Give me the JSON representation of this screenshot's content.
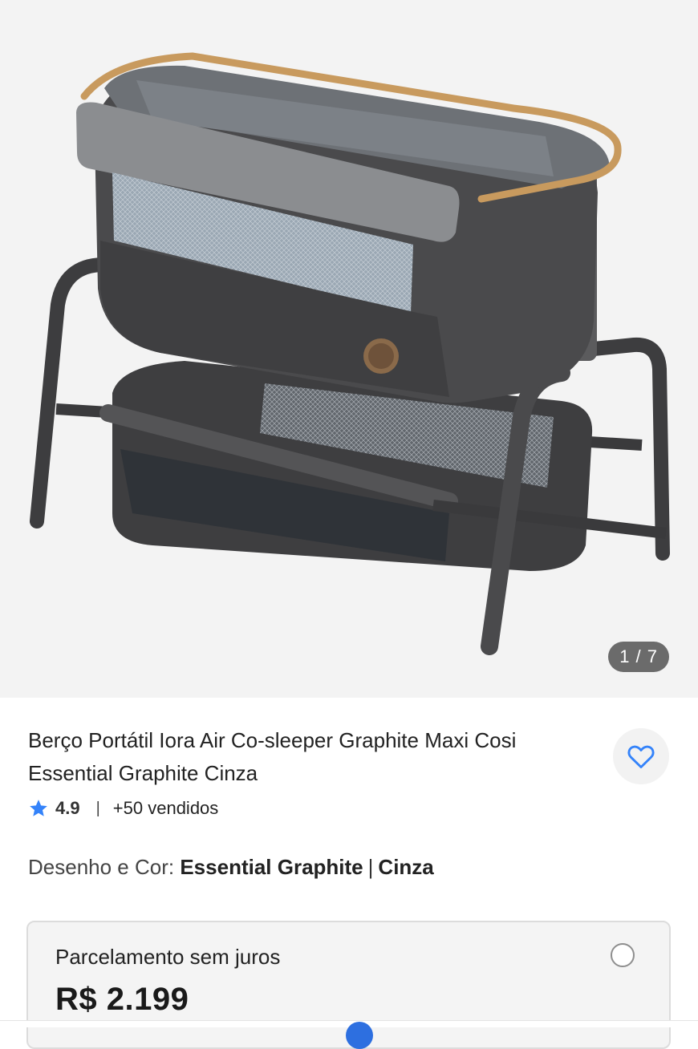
{
  "gallery": {
    "image_alt": "Berço Portátil Iora Air Co-sleeper Graphite Maxi Cosi",
    "counter": "1 / 7"
  },
  "product": {
    "title": "Berço Portátil Iora Air Co-sleeper Graphite Maxi Cosi Essential Graphite Cinza",
    "rating": "4.9",
    "separator": "|",
    "sold": "+50 vendidos"
  },
  "variant": {
    "label": "Desenho e Cor:",
    "design": "Essential Graphite",
    "divider": "|",
    "color": "Cinza"
  },
  "payment": {
    "label": "Parcelamento sem juros",
    "price": "R$ 2.199"
  },
  "icons": {
    "favorite": "heart-icon",
    "rating": "star-icon",
    "payment_select": "radio-icon"
  },
  "colors": {
    "accent": "#3483fa",
    "gallery_bg": "#f3f3f3",
    "product_graphite": "#4a4a4c",
    "wood": "#c89a5e"
  }
}
